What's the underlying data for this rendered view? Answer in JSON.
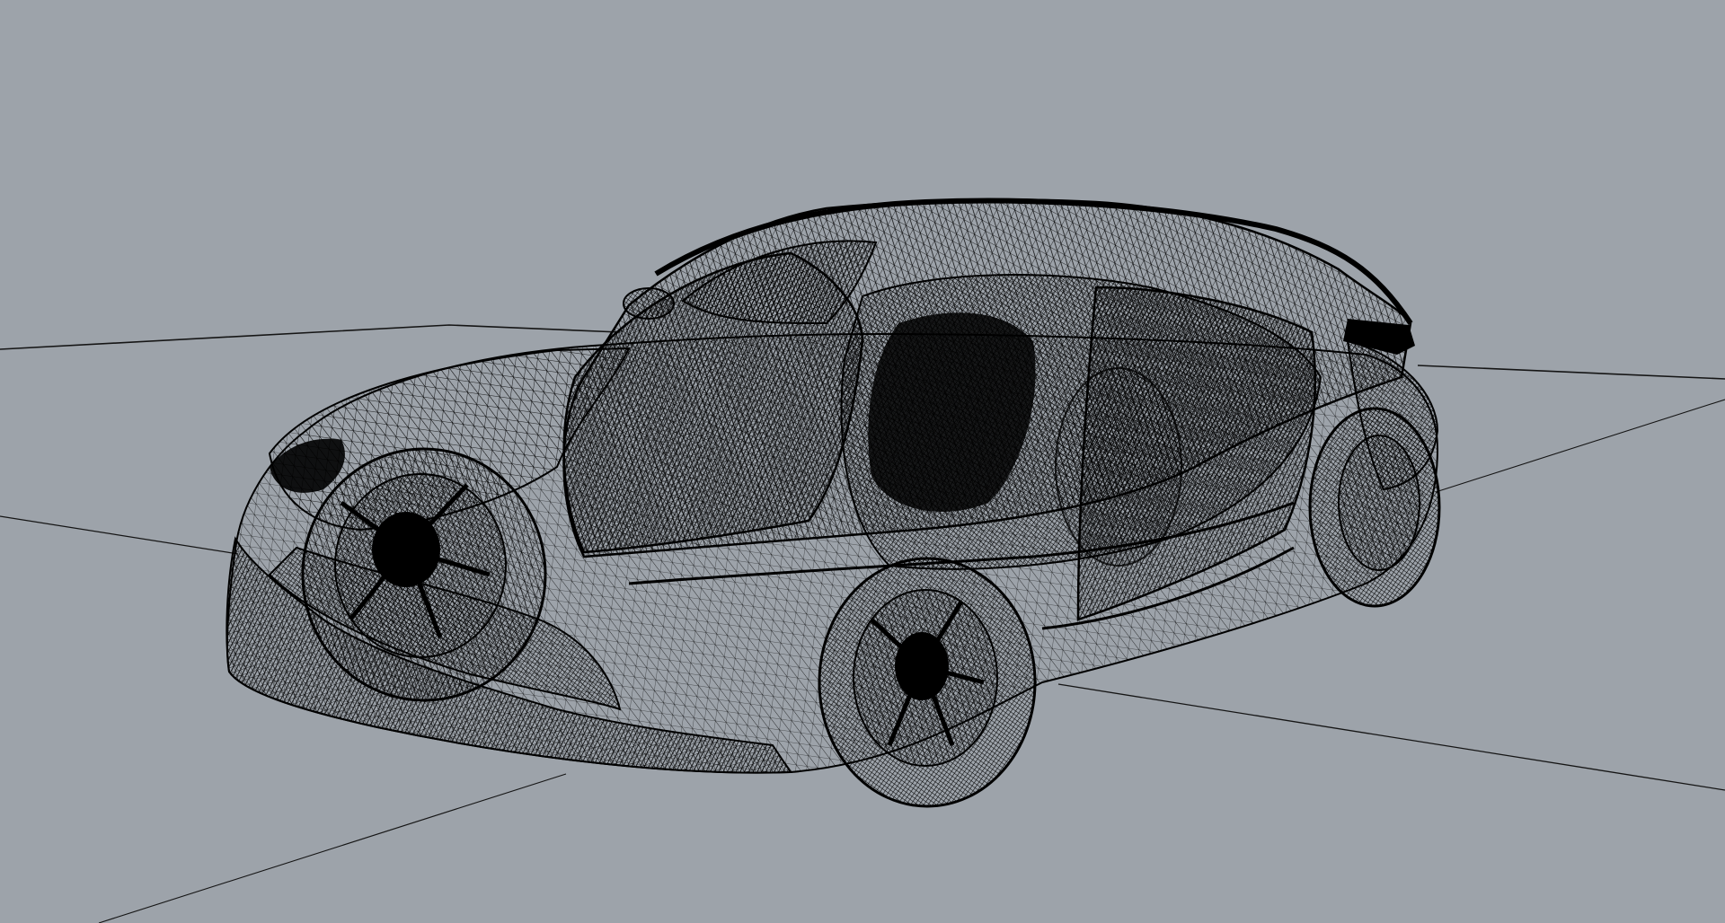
{
  "viewport": {
    "display_mode": "wireframe",
    "background_color": "#9da3aa",
    "wire_color": "#000000",
    "grid_line_color": "#1a1a1a",
    "subject": "car-wireframe-model"
  }
}
